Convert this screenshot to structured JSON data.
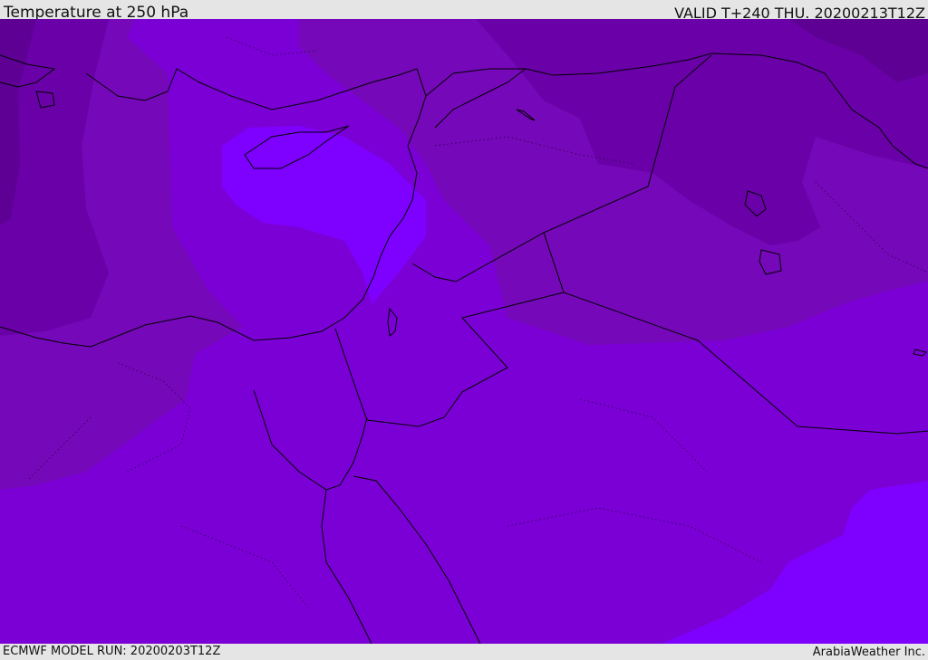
{
  "header": {
    "title": "Temperature at 250 hPa",
    "valid": "VALID T+240 THU. 20200213T12Z"
  },
  "footer": {
    "model_run": "ECMWF MODEL RUN: 20200203T12Z",
    "credit": "ArabiaWeather Inc."
  },
  "colors": {
    "band_darkest": "#5e0094",
    "band_dark": "#6a00a8",
    "band_mid": "#7508b8",
    "band_main": "#7b00d6",
    "band_light": "#7e00ff",
    "coastline": "#000000"
  }
}
